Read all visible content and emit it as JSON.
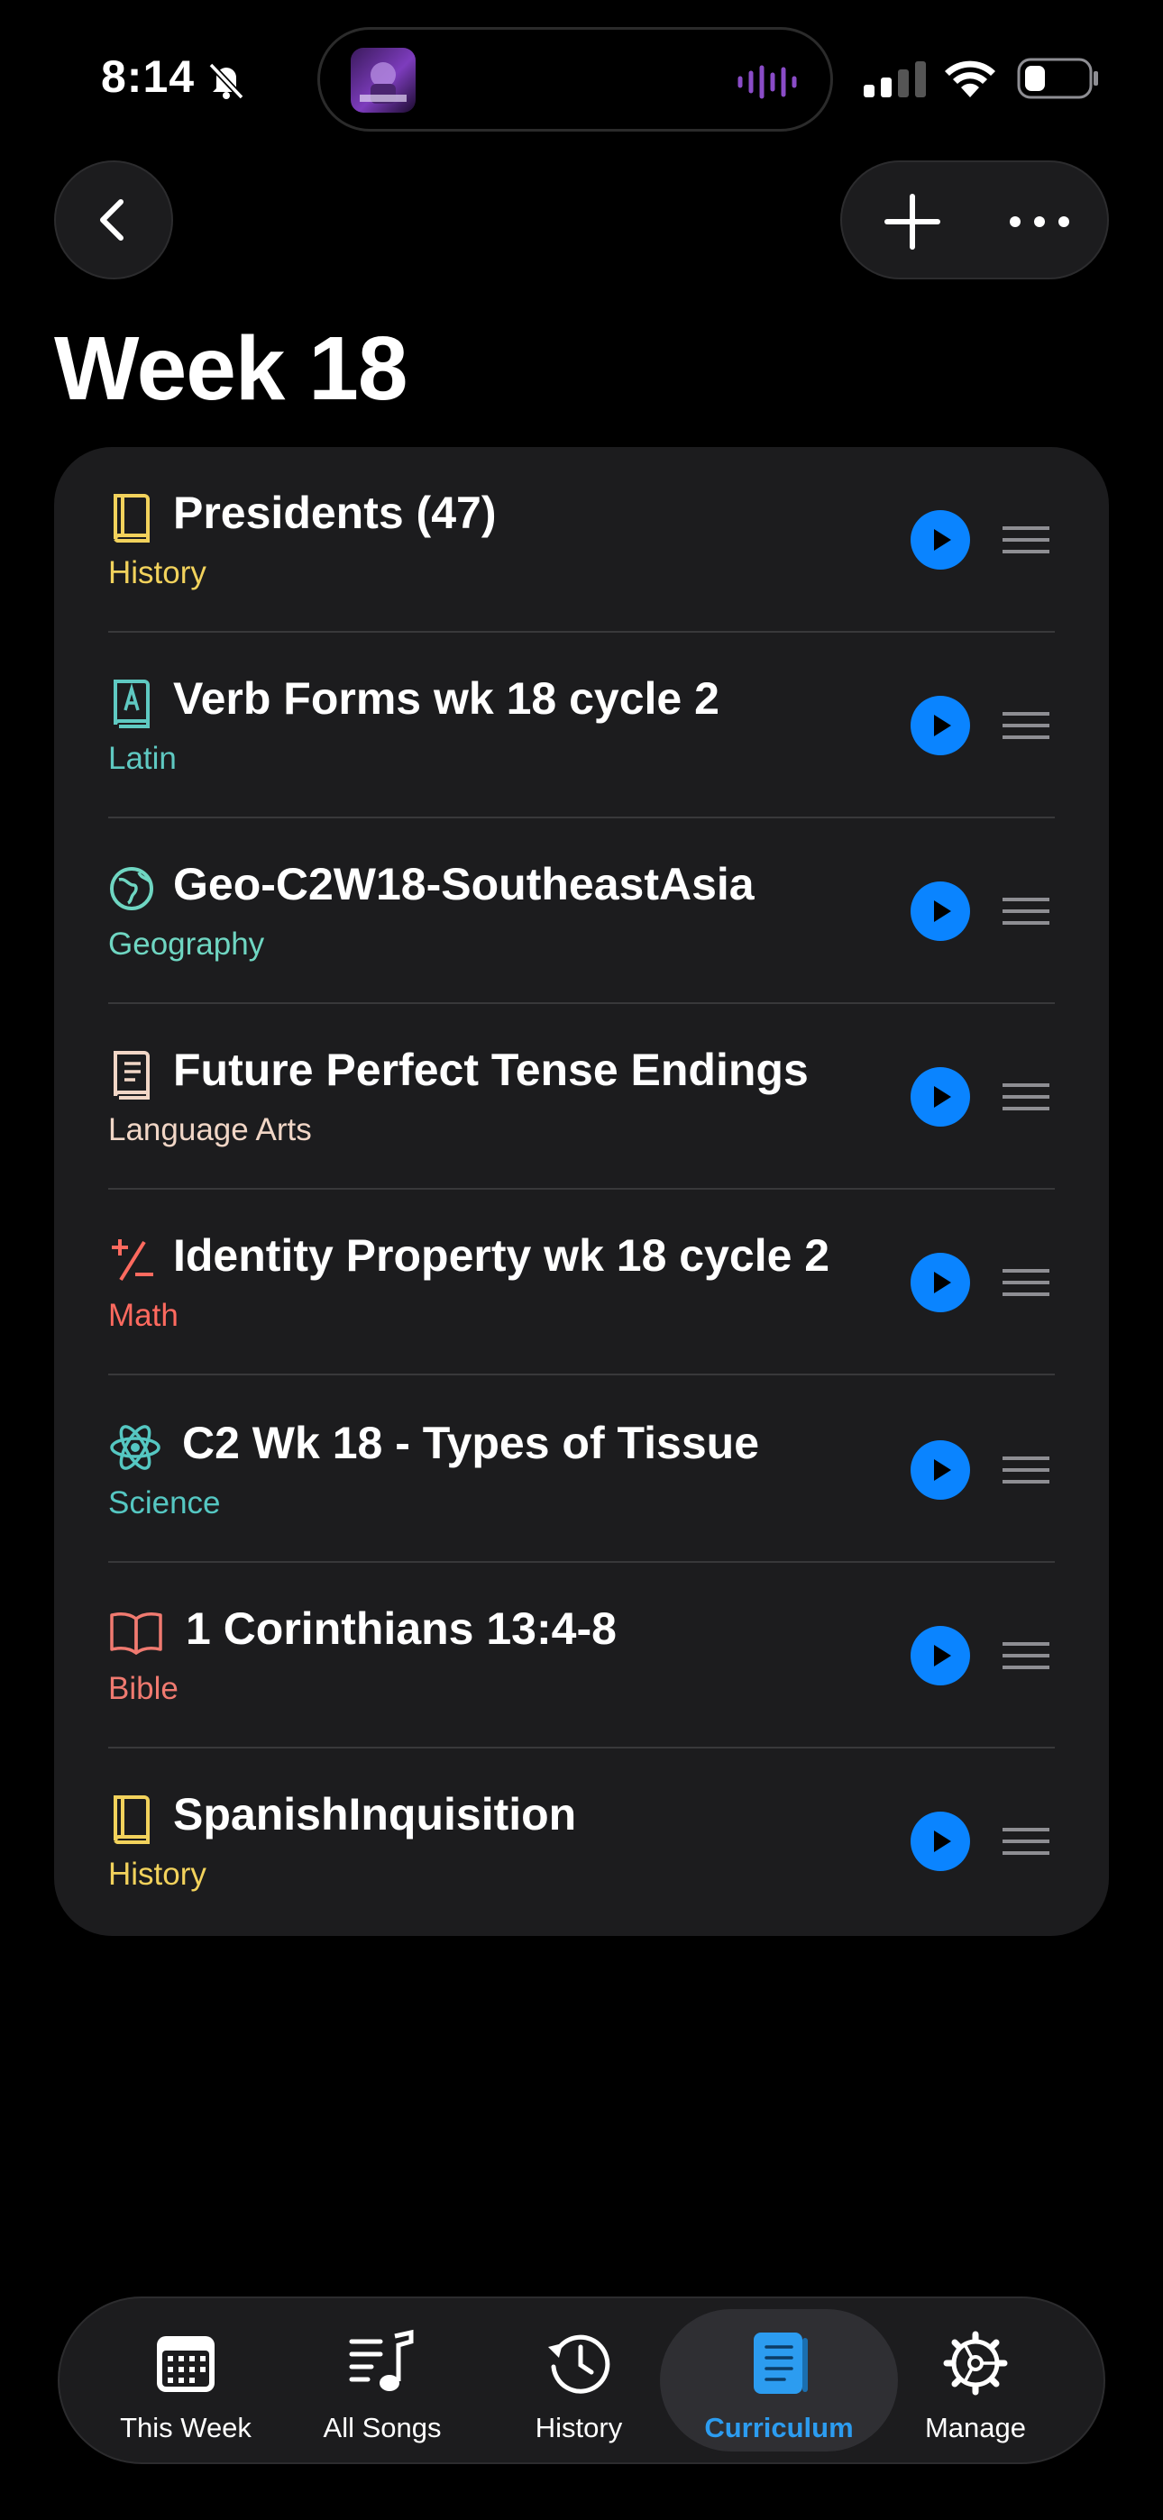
{
  "status_bar": {
    "time": "8:14"
  },
  "island": {
    "album_art": "Room of Death album art"
  },
  "header": {
    "title": "Week 18"
  },
  "items": [
    {
      "title": "Presidents (47)",
      "subject": "History",
      "icon": "book-closed-icon",
      "color": "#f2d25c"
    },
    {
      "title": "Verb Forms wk 18 cycle 2",
      "subject": "Latin",
      "icon": "language-book-icon",
      "color": "#5fc9c2"
    },
    {
      "title": "Geo-C2W18-SoutheastAsia",
      "subject": "Geography",
      "icon": "globe-icon",
      "color": "#6fd6c2"
    },
    {
      "title": "Future Perfect Tense Endings",
      "subject": "Language Arts",
      "icon": "text-book-icon",
      "color": "#f1d6c6"
    },
    {
      "title": "Identity Property wk 18 cycle 2",
      "subject": "Math",
      "icon": "plus-minus-icon",
      "color": "#ff6a5f"
    },
    {
      "title": "C2 Wk 18 - Types of Tissue",
      "subject": "Science",
      "icon": "atom-icon",
      "color": "#55c7c2"
    },
    {
      "title": "1 Corinthians 13:4-8",
      "subject": "Bible",
      "icon": "open-book-icon",
      "color": "#f07a70"
    },
    {
      "title": "SpanishInquisition",
      "subject": "History",
      "icon": "book-closed-icon",
      "color": "#f2d25c"
    }
  ],
  "tabs": [
    {
      "label": "This Week",
      "icon": "calendar-icon",
      "active": false
    },
    {
      "label": "All Songs",
      "icon": "music-list-icon",
      "active": false
    },
    {
      "label": "History",
      "icon": "clock-history-icon",
      "active": false
    },
    {
      "label": "Curriculum",
      "icon": "curriculum-book-icon",
      "active": true
    },
    {
      "label": "Manage",
      "icon": "gear-icon",
      "active": false
    }
  ],
  "colors": {
    "accent": "#0a84ff",
    "active_tab": "#2c9cf0",
    "card": "#1c1c1e"
  }
}
